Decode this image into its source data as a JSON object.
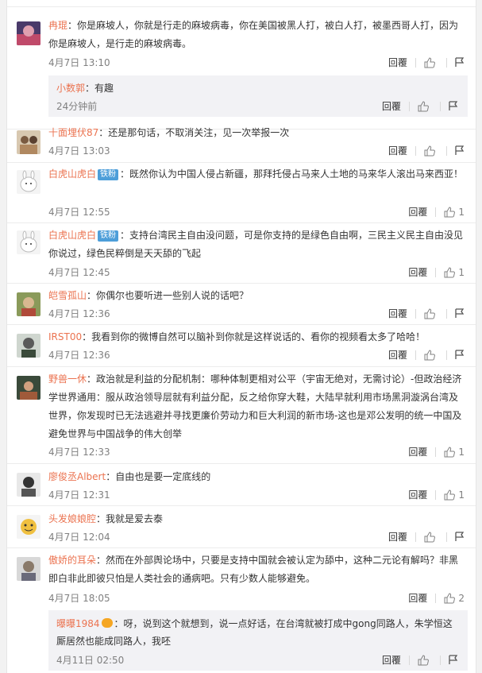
{
  "comments": [
    {
      "user": "冉琨",
      "badge": "",
      "text": "：你是麻坡人，你就是行走的麻坡病毒，你在美国被黑人打，被白人打，被墨西哥人打，因为你是麻坡人，是行走的麻坡病毒。",
      "time": "4月7日 13:10",
      "reply_label": "回覆",
      "likes": "",
      "report": "",
      "reply": {
        "user": "小数郭",
        "text": "：有趣",
        "time": "24分钟前",
        "reply_label": "回覆",
        "likes": "",
        "report": ""
      }
    },
    {
      "user": "十面埋伏87",
      "badge": "",
      "text": "：还是那句话，不取消关注，见一次举报一次",
      "time": "4月7日 13:03",
      "reply_label": "回覆",
      "likes": "",
      "report": ""
    },
    {
      "user": "白虎山虎白",
      "badge": "铁粉",
      "text": "：既然你认为中国人侵占新疆，那拜托侵占马来人土地的马来华人滚出马来西亚！",
      "time": "4月7日 12:55",
      "reply_label": "回覆",
      "likes": "1",
      "report": ""
    },
    {
      "user": "白虎山虎白",
      "badge": "铁粉",
      "text": "：支持台湾民主自由没问题，可是你支持的是绿色自由啊，三民主义民主自由没见你说过，绿色民粹倒是天天舔的飞起",
      "time": "4月7日 12:45",
      "reply_label": "回覆",
      "likes": "1",
      "report": ""
    },
    {
      "user": "皑雪孤山",
      "badge": "",
      "text": "：你偶尔也要听进一些别人说的话吧？",
      "time": "4月7日 12:36",
      "reply_label": "回覆",
      "likes": "",
      "report": ""
    },
    {
      "user": "IRST00",
      "badge": "",
      "text": "：我看到你的微博自然可以脑补到你就是这样说话的、看你的视频看太多了哈哈！",
      "time": "4月7日 12:36",
      "reply_label": "回覆",
      "likes": "",
      "report": ""
    },
    {
      "user": "野兽一休",
      "badge": "",
      "text": "：政治就是利益的分配机制：哪种体制更相对公平（宇宙无绝对，无需讨论）-但政治经济学世界通用：服从政治领导层就有利益分配，反之给你穿大鞋，大陆早就利用市场黑洞漩涡台湾及世界，你发现时已无法逃避并寻找更廉价劳动力和巨大利润的新市场-这也是邓公发明的统一中国及避免世界与中国战争的伟大创举",
      "time": "4月7日 12:33",
      "reply_label": "回覆",
      "likes": "1",
      "report": ""
    },
    {
      "user": "廖俊丞Albert",
      "badge": "",
      "text": "：自由也是要一定底线的",
      "time": "4月7日 12:31",
      "reply_label": "回覆",
      "likes": "1",
      "report": ""
    },
    {
      "user": "头发娘娘腔",
      "badge": "",
      "text": "：我就是爱去泰",
      "time": "4月7日 12:04",
      "reply_label": "回覆",
      "likes": "",
      "report": ""
    },
    {
      "user": "傲娇的耳朵",
      "badge": "",
      "text": "：然而在外部舆论场中，只要是支持中国就会被认定为舔中，这种二元论有解吗？非黑即白非此即彼只怕是人类社会的通病吧。只有少数人能够避免。",
      "time": "4月7日 18:05",
      "reply_label": "回覆",
      "likes": "2",
      "report": "",
      "reply": {
        "user": "曝曝1984",
        "text": "：呀，说到这个就想到，说一点好话，在台湾就被打成中gong同路人，朱学恒这厮居然也能成同路人，我呸",
        "time": "4月11日 02:50",
        "reply_label": "回覆",
        "likes": "",
        "report": ""
      }
    }
  ],
  "colors": {
    "username": "#eb7350",
    "badge": "#4d9ed9",
    "meta": "#808080",
    "reply_bg": "#f2f2f5"
  }
}
